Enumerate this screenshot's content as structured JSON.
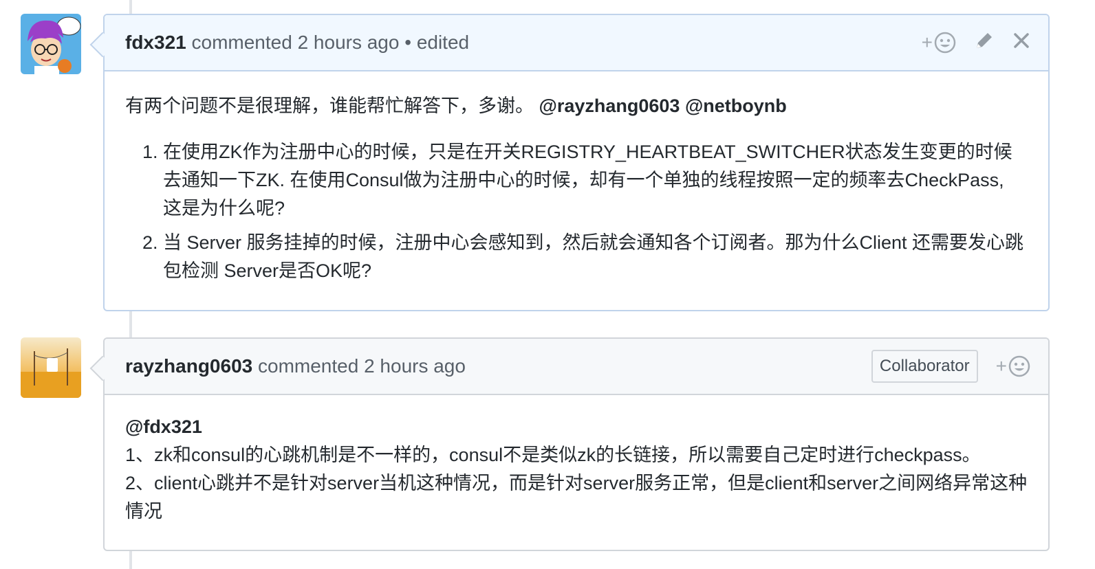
{
  "comments": [
    {
      "author": "fdx321",
      "meta": " commented 2 hours ago • edited",
      "intro": "有两个问题不是很理解，谁能帮忙解答下，多谢。",
      "mentions": "@rayzhang0603 @netboynb",
      "list": [
        "在使用ZK作为注册中心的时候，只是在开关REGISTRY_HEARTBEAT_SWITCHER状态发生变更的时候去通知一下ZK. 在使用Consul做为注册中心的时候，却有一个单独的线程按照一定的频率去CheckPass, 这是为什么呢?",
        "当 Server 服务挂掉的时候，注册中心会感知到，然后就会通知各个订阅者。那为什么Client 还需要发心跳包检测 Server是否OK呢?"
      ],
      "reaction_plus": "+"
    },
    {
      "author": "rayzhang0603",
      "meta": " commented 2 hours ago",
      "badge": "Collaborator",
      "mention": "@fdx321",
      "lines": [
        "1、zk和consul的心跳机制是不一样的，consul不是类似zk的长链接，所以需要自己定时进行checkpass。",
        "2、client心跳并不是针对server当机这种情况，而是针对server服务正常，但是client和server之间网络异常这种情况"
      ],
      "reaction_plus": "+"
    }
  ],
  "icons": [
    "smiley-icon",
    "pencil-icon",
    "close-icon"
  ],
  "colors": {
    "header_blue": "#f1f8ff",
    "header_gray": "#f6f8fa",
    "border_blue": "#c0d3eb",
    "border_gray": "#d1d5da"
  }
}
